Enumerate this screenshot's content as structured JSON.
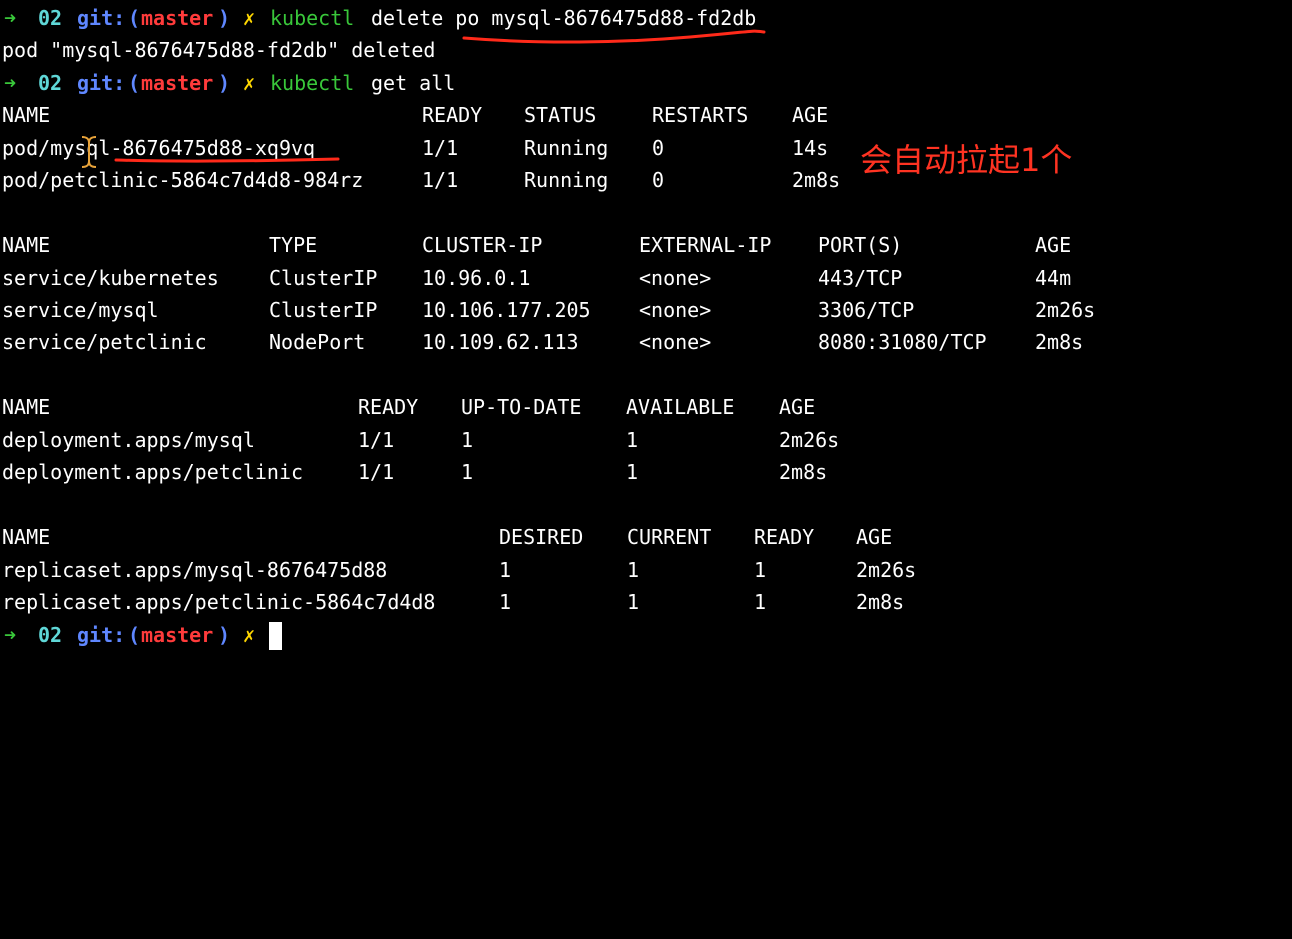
{
  "prompt": {
    "arrow": "➜",
    "dir": "02",
    "git_label": "git:",
    "open_paren": "(",
    "branch": "master",
    "close_paren": ")",
    "dirty": "✗"
  },
  "commands": {
    "delete": {
      "program": "kubectl",
      "args": "delete po mysql-8676475d88-fd2db"
    },
    "get_all": {
      "program": "kubectl",
      "args": "get all"
    }
  },
  "delete_output": "pod \"mysql-8676475d88-fd2db\" deleted",
  "pods": {
    "headers": [
      "NAME",
      "READY",
      "STATUS",
      "RESTARTS",
      "AGE"
    ],
    "rows": [
      [
        "pod/mysql-8676475d88-xq9vq",
        "1/1",
        "Running",
        "0",
        "14s"
      ],
      [
        "pod/petclinic-5864c7d4d8-984rz",
        "1/1",
        "Running",
        "0",
        "2m8s"
      ]
    ]
  },
  "services": {
    "headers": [
      "NAME",
      "TYPE",
      "CLUSTER-IP",
      "EXTERNAL-IP",
      "PORT(S)",
      "AGE"
    ],
    "rows": [
      [
        "service/kubernetes",
        "ClusterIP",
        "10.96.0.1",
        "<none>",
        "443/TCP",
        "44m"
      ],
      [
        "service/mysql",
        "ClusterIP",
        "10.106.177.205",
        "<none>",
        "3306/TCP",
        "2m26s"
      ],
      [
        "service/petclinic",
        "NodePort",
        "10.109.62.113",
        "<none>",
        "8080:31080/TCP",
        "2m8s"
      ]
    ]
  },
  "deployments": {
    "headers": [
      "NAME",
      "READY",
      "UP-TO-DATE",
      "AVAILABLE",
      "AGE"
    ],
    "rows": [
      [
        "deployment.apps/mysql",
        "1/1",
        "1",
        "1",
        "2m26s"
      ],
      [
        "deployment.apps/petclinic",
        "1/1",
        "1",
        "1",
        "2m8s"
      ]
    ]
  },
  "replicasets": {
    "headers": [
      "NAME",
      "DESIRED",
      "CURRENT",
      "READY",
      "AGE"
    ],
    "rows": [
      [
        "replicaset.apps/mysql-8676475d88",
        "1",
        "1",
        "1",
        "2m26s"
      ],
      [
        "replicaset.apps/petclinic-5864c7d4d8",
        "1",
        "1",
        "1",
        "2m8s"
      ]
    ]
  },
  "annotation": "会自动拉起1个",
  "colors": {
    "background": "#000000",
    "arrow": "#39c73a",
    "dir": "#5fd7d7",
    "git": "#5f87ff",
    "branch": "#ff3b3b",
    "dirty": "#ffd700",
    "annotation": "#ff3322"
  }
}
